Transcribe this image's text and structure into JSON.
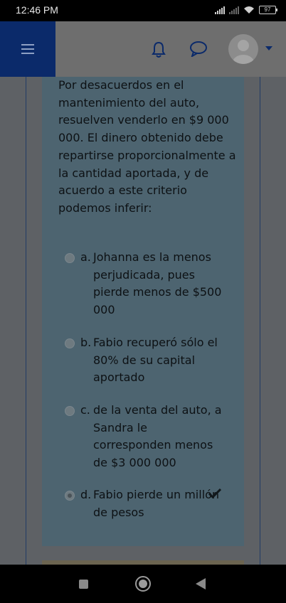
{
  "status_bar": {
    "time": "12:46 PM",
    "battery": "97"
  },
  "header": {
    "menu_icon": "hamburger-icon",
    "notification_icon": "bell-icon",
    "messages_icon": "chat-bubble-icon",
    "avatar_icon": "user-avatar",
    "dropdown_icon": "caret-down-icon"
  },
  "question": {
    "text": "Por desacuerdos en el mantenimiento del auto, resuelven venderlo en $9 000 000. El dinero obtenido debe repartirse proporcionalmente a la cantidad aportada, y de acuerdo a este criterio podemos inferir:"
  },
  "options": [
    {
      "letter": "a.",
      "text": "Johanna es la menos perjudicada, pues pierde menos de $500 000",
      "selected": false
    },
    {
      "letter": "b.",
      "text": "Fabio recuperó sólo el 80% de su capital aportado",
      "selected": false
    },
    {
      "letter": "c.",
      "text": "de la venta del auto, a Sandra le corresponden menos de $3 000 000",
      "selected": false
    },
    {
      "letter": "d.",
      "text": "Fabio pierde un millón de pesos",
      "selected": true,
      "mark": "check-icon"
    }
  ],
  "nav_bar": {
    "recent_icon": "square-icon",
    "home_icon": "circle-icon",
    "back_icon": "triangle-back-icon"
  },
  "colors": {
    "header_menu_bg": "#0b2a6a",
    "overlay_dim": "#5e6165",
    "card_bg": "#4d6470"
  }
}
